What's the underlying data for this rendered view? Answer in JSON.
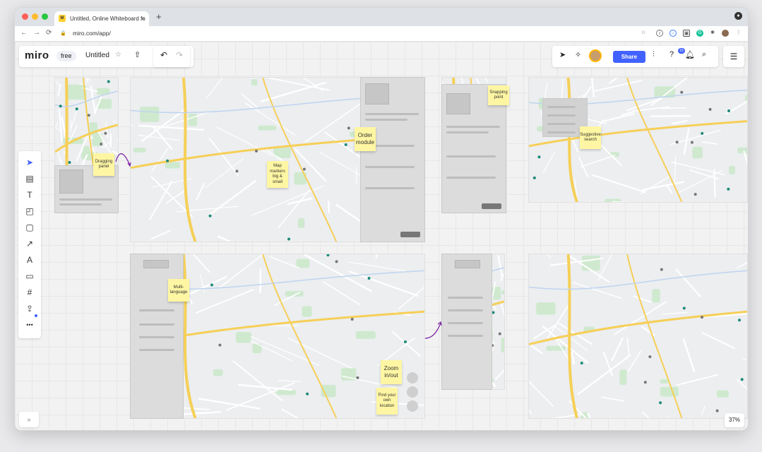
{
  "browser": {
    "tab_title": "Untitled, Online Whiteboard fo",
    "favicon_text": "M",
    "close_tab": "×",
    "new_tab": "+",
    "url": "miro.com/app/",
    "nav": {
      "back": "←",
      "forward": "→",
      "reload": "⟳",
      "lock": "🔒"
    }
  },
  "app": {
    "logo": "miro",
    "plan": "free",
    "board_title": "Untitled",
    "star": "☆",
    "upload": "⇧",
    "undo": "↶",
    "redo": "↷",
    "share": "Share",
    "notifications_badge": "15",
    "zoom_level": "37%",
    "expand": "»"
  },
  "toolbar": {
    "items": [
      {
        "name": "select-tool",
        "glyph": "➤"
      },
      {
        "name": "frame-template-tool",
        "glyph": "▤"
      },
      {
        "name": "text-tool",
        "glyph": "T"
      },
      {
        "name": "sticky-note-tool",
        "glyph": "◰"
      },
      {
        "name": "shape-tool",
        "glyph": "▢"
      },
      {
        "name": "arrow-tool",
        "glyph": "↗"
      },
      {
        "name": "pen-tool",
        "glyph": "A"
      },
      {
        "name": "comment-tool",
        "glyph": "▭"
      },
      {
        "name": "frame-tool",
        "glyph": "#"
      },
      {
        "name": "upload-tool",
        "glyph": "⇪"
      },
      {
        "name": "more-tools",
        "glyph": "•••"
      }
    ]
  },
  "stickies": {
    "dragging": "Dragging panel",
    "map_markers": "Map markers big & small",
    "order": "Order module",
    "snapping": "Snapping point",
    "suggestive": "Suggestive search",
    "multi": "Multi-language",
    "zoom": "Zoom in/out",
    "find": "Find your own location"
  },
  "colors": {
    "accent": "#4262ff",
    "sticky": "#fff6a3",
    "arrow": "#7a1fa2"
  }
}
